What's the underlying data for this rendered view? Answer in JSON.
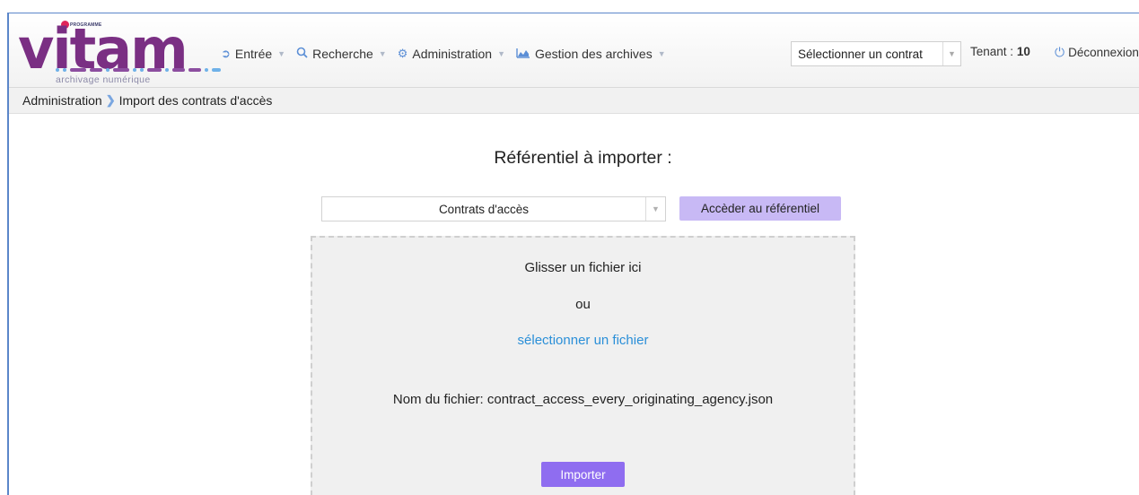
{
  "header": {
    "logo": {
      "program_text": "PROGRAMME",
      "wordmark": "vitam",
      "tagline": "archivage numérique"
    },
    "nav": [
      {
        "label": "Entrée",
        "icon": "sign-in-icon"
      },
      {
        "label": "Recherche",
        "icon": "search-icon"
      },
      {
        "label": "Administration",
        "icon": "gears-icon"
      },
      {
        "label": "Gestion des archives",
        "icon": "chart-icon"
      }
    ],
    "contract_select": {
      "value": "Sélectionner un contrat"
    },
    "tenant": {
      "label": "Tenant :",
      "value": "10"
    },
    "logout_label": "Déconnexion"
  },
  "breadcrumb": {
    "root": "Administration",
    "current": "Import des contrats d'accès"
  },
  "main": {
    "title": "Référentiel à importer :",
    "ref_select_value": "Contrats d'accès",
    "ref_button_label": "Accèder au référentiel",
    "dropzone": {
      "drop_text": "Glisser un fichier ici",
      "or_text": "ou",
      "select_link": "sélectionner un fichier",
      "filename_text": "Nom du fichier: contract_access_every_originating_agency.json",
      "import_button": "Importer"
    }
  },
  "colors": {
    "accent_purple": "#8f6df0",
    "light_purple": "#c8b9f5",
    "link_blue": "#2a8fd8",
    "icon_blue": "#5c8fd6",
    "logo_purple": "#7a2f83"
  }
}
